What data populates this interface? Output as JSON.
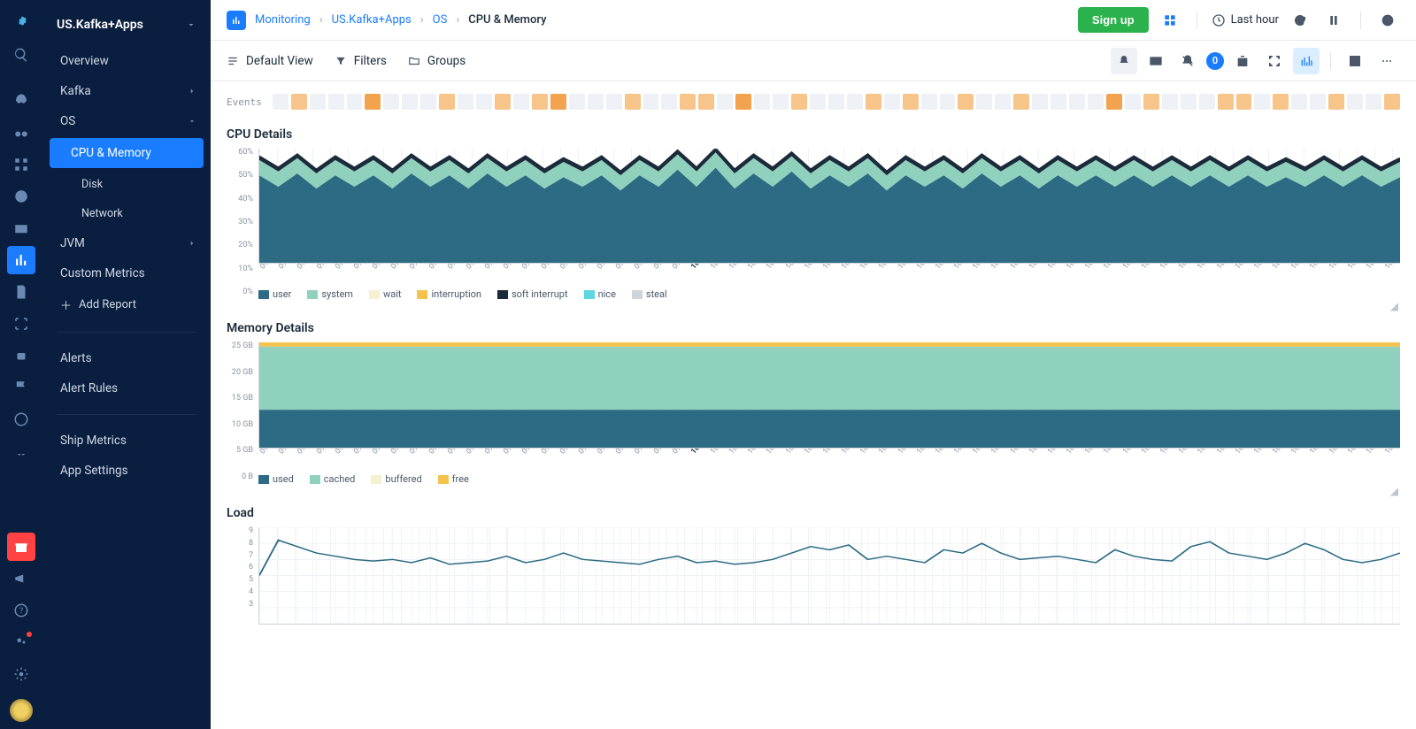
{
  "app_name": "US.Kafka+Apps",
  "breadcrumbs": [
    "Monitoring",
    "US.Kafka+Apps",
    "OS",
    "CPU & Memory"
  ],
  "actions": {
    "signup": "Sign up",
    "time_range": "Last hour"
  },
  "toolbar": {
    "default_view": "Default View",
    "filters": "Filters",
    "groups": "Groups",
    "badge": "0"
  },
  "sidebar": {
    "items": [
      {
        "label": "Overview"
      },
      {
        "label": "Kafka",
        "expandable": true
      },
      {
        "label": "OS",
        "expandable": true,
        "open": true,
        "children": [
          {
            "label": "CPU & Memory",
            "selected": true
          },
          {
            "label": "Disk"
          },
          {
            "label": "Network"
          }
        ]
      },
      {
        "label": "JVM",
        "expandable": true
      },
      {
        "label": "Custom Metrics"
      }
    ],
    "add_report": "Add Report",
    "group2": [
      {
        "label": "Alerts"
      },
      {
        "label": "Alert Rules"
      }
    ],
    "group3": [
      {
        "label": "Ship Metrics"
      },
      {
        "label": "App Settings"
      }
    ]
  },
  "events_label": "Events",
  "events_cells": [
    "g",
    "o1",
    "g",
    "g",
    "g",
    "o2",
    "g",
    "g",
    "g",
    "o1",
    "g",
    "g",
    "o1",
    "g",
    "o1",
    "o2",
    "g",
    "g",
    "g",
    "o1",
    "g",
    "g",
    "o1",
    "o1",
    "g",
    "o2",
    "g",
    "g",
    "o1",
    "g",
    "g",
    "g",
    "o1",
    "g",
    "o1",
    "g",
    "g",
    "o1",
    "g",
    "g",
    "o1",
    "g",
    "g",
    "g",
    "g",
    "o2",
    "g",
    "o1",
    "g",
    "g",
    "g",
    "o1",
    "o1",
    "g",
    "o1",
    "g",
    "g",
    "o1",
    "g",
    "g",
    "o1"
  ],
  "time_ticks": [
    "09:37",
    "09:38",
    "09:39",
    "09:40",
    "09:41",
    "09:42",
    "09:43",
    "09:44",
    "09:45",
    "09:46",
    "09:47",
    "09:48",
    "09:49",
    "09:50",
    "09:51",
    "09:52",
    "09:53",
    "09:54",
    "09:55",
    "09:56",
    "09:57",
    "09:58",
    "09:59",
    "10:00",
    "10:01",
    "10:02",
    "10:03",
    "10:04",
    "10:05",
    "10:06",
    "10:07",
    "10:08",
    "10:09",
    "10:10",
    "10:11",
    "10:12",
    "10:13",
    "10:14",
    "10:15",
    "10:16",
    "10:17",
    "10:18",
    "10:19",
    "10:20",
    "10:21",
    "10:22",
    "10:23",
    "10:24",
    "10:25",
    "10:26",
    "10:27",
    "10:28",
    "10:29",
    "10:30",
    "10:31",
    "10:32",
    "10:33",
    "10:34",
    "10:35",
    "10:36",
    "10:37"
  ],
  "panels": {
    "cpu": {
      "title": "CPU Details",
      "y_ticks": [
        "60%",
        "50%",
        "40%",
        "30%",
        "20%",
        "10%",
        "0%"
      ],
      "legend": [
        "user",
        "system",
        "wait",
        "interruption",
        "soft interrupt",
        "nice",
        "steal"
      ],
      "legend_colors": [
        "#2d6b84",
        "#8fd1bd",
        "#f5f0d0",
        "#f5c24e",
        "#1c2b3a",
        "#5cd6e0",
        "#d0d5dc"
      ]
    },
    "memory": {
      "title": "Memory Details",
      "y_ticks": [
        "25 GB",
        "20 GB",
        "15 GB",
        "10 GB",
        "5 GB",
        "0 B"
      ],
      "legend": [
        "used",
        "cached",
        "buffered",
        "free"
      ],
      "legend_colors": [
        "#2d6b84",
        "#8fd1bd",
        "#f5f0d0",
        "#f5c24e"
      ]
    },
    "load": {
      "title": "Load",
      "y_ticks": [
        "9",
        "8",
        "7",
        "6",
        "5",
        "4",
        "3"
      ]
    }
  },
  "chart_data": [
    {
      "type": "area",
      "title": "CPU Details",
      "ylabel": "%",
      "ylim": [
        0,
        60
      ],
      "x": [
        "09:37",
        "09:38",
        "09:39",
        "09:40",
        "09:41",
        "09:42",
        "09:43",
        "09:44",
        "09:45",
        "09:46",
        "09:47",
        "09:48",
        "09:49",
        "09:50",
        "09:51",
        "09:52",
        "09:53",
        "09:54",
        "09:55",
        "09:56",
        "09:57",
        "09:58",
        "09:59",
        "10:00",
        "10:01",
        "10:02",
        "10:03",
        "10:04",
        "10:05",
        "10:06",
        "10:07",
        "10:08",
        "10:09",
        "10:10",
        "10:11",
        "10:12",
        "10:13",
        "10:14",
        "10:15",
        "10:16",
        "10:17",
        "10:18",
        "10:19",
        "10:20",
        "10:21",
        "10:22",
        "10:23",
        "10:24",
        "10:25",
        "10:26",
        "10:27",
        "10:28",
        "10:29",
        "10:30",
        "10:31",
        "10:32",
        "10:33",
        "10:34",
        "10:35",
        "10:36",
        "10:37"
      ],
      "series": [
        {
          "name": "user",
          "values": [
            46,
            40,
            47,
            39,
            46,
            40,
            46,
            39,
            47,
            40,
            46,
            39,
            47,
            40,
            46,
            39,
            45,
            40,
            46,
            38,
            46,
            40,
            49,
            40,
            50,
            39,
            47,
            40,
            48,
            39,
            46,
            40,
            47,
            38,
            46,
            40,
            46,
            39,
            47,
            40,
            46,
            39,
            46,
            40,
            46,
            40,
            46,
            40,
            46,
            40,
            46,
            40,
            46,
            40,
            45,
            40,
            46,
            40,
            46,
            40,
            45
          ]
        },
        {
          "name": "system",
          "values": [
            8,
            8,
            8,
            8,
            8,
            8,
            8,
            8,
            8,
            8,
            8,
            8,
            8,
            8,
            8,
            8,
            8,
            8,
            8,
            8,
            8,
            8,
            8,
            8,
            8,
            8,
            8,
            8,
            8,
            8,
            8,
            8,
            8,
            8,
            8,
            8,
            8,
            8,
            8,
            8,
            8,
            8,
            8,
            8,
            8,
            8,
            8,
            8,
            8,
            8,
            8,
            8,
            8,
            8,
            8,
            8,
            8,
            8,
            8,
            8,
            8
          ]
        },
        {
          "name": "soft interrupt",
          "values": [
            2,
            2,
            2,
            2,
            2,
            2,
            2,
            2,
            2,
            2,
            2,
            2,
            2,
            2,
            2,
            2,
            2,
            2,
            2,
            2,
            2,
            2,
            2,
            2,
            2,
            2,
            2,
            2,
            2,
            2,
            2,
            2,
            2,
            2,
            2,
            2,
            2,
            2,
            2,
            2,
            2,
            2,
            2,
            2,
            2,
            2,
            2,
            2,
            2,
            2,
            2,
            2,
            2,
            2,
            2,
            2,
            2,
            2,
            2,
            2,
            2
          ]
        }
      ]
    },
    {
      "type": "area",
      "title": "Memory Details",
      "ylabel": "GB",
      "ylim": [
        0,
        25
      ],
      "x": [
        "09:37",
        "09:38",
        "09:39",
        "09:40",
        "09:41",
        "09:42",
        "09:43",
        "09:44",
        "09:45",
        "09:46",
        "09:47",
        "09:48",
        "09:49",
        "09:50",
        "09:51",
        "09:52",
        "09:53",
        "09:54",
        "09:55",
        "09:56",
        "09:57",
        "09:58",
        "09:59",
        "10:00",
        "10:01",
        "10:02",
        "10:03",
        "10:04",
        "10:05",
        "10:06",
        "10:07",
        "10:08",
        "10:09",
        "10:10",
        "10:11",
        "10:12",
        "10:13",
        "10:14",
        "10:15",
        "10:16",
        "10:17",
        "10:18",
        "10:19",
        "10:20",
        "10:21",
        "10:22",
        "10:23",
        "10:24",
        "10:25",
        "10:26",
        "10:27",
        "10:28",
        "10:29",
        "10:30",
        "10:31",
        "10:32",
        "10:33",
        "10:34",
        "10:35",
        "10:36",
        "10:37"
      ],
      "series": [
        {
          "name": "used",
          "values": [
            9,
            9,
            9,
            9,
            9,
            9,
            9,
            9,
            9,
            9,
            9,
            9,
            9,
            9,
            9,
            9,
            9,
            9,
            9,
            9,
            9,
            9,
            9,
            9,
            9,
            9,
            9,
            9,
            9,
            9,
            9,
            9,
            9,
            9,
            9,
            9,
            9,
            9,
            9,
            9,
            9,
            9,
            9,
            9,
            9,
            9,
            9,
            9,
            9,
            9,
            9,
            9,
            9,
            9,
            9,
            9,
            9,
            9,
            9,
            9,
            9
          ]
        },
        {
          "name": "cached",
          "values": [
            15,
            15,
            15,
            15,
            15,
            15,
            15,
            15,
            15,
            15,
            15,
            15,
            15,
            15,
            15,
            15,
            15,
            15,
            15,
            15,
            15,
            15,
            15,
            15,
            15,
            15,
            15,
            15,
            15,
            15,
            15,
            15,
            15,
            15,
            15,
            15,
            15,
            15,
            15,
            15,
            15,
            15,
            15,
            15,
            15,
            15,
            15,
            15,
            15,
            15,
            15,
            15,
            15,
            15,
            15,
            15,
            15,
            15,
            15,
            15,
            15
          ]
        },
        {
          "name": "free",
          "values": [
            1,
            1,
            1,
            1,
            1,
            1,
            1,
            1,
            1,
            1,
            1,
            1,
            1,
            1,
            1,
            1,
            1,
            1,
            1,
            1,
            1,
            1,
            1,
            1,
            1,
            1,
            1,
            1,
            1,
            1,
            1,
            1,
            1,
            1,
            1,
            1,
            1,
            1,
            1,
            1,
            1,
            1,
            1,
            1,
            1,
            1,
            1,
            1,
            1,
            1,
            1,
            1,
            1,
            1,
            1,
            1,
            1,
            1,
            1,
            1,
            1
          ]
        }
      ]
    },
    {
      "type": "line",
      "title": "Load",
      "ylim": [
        3,
        9
      ],
      "x": [
        "09:37",
        "09:38",
        "09:39",
        "09:40",
        "09:41",
        "09:42",
        "09:43",
        "09:44",
        "09:45",
        "09:46",
        "09:47",
        "09:48",
        "09:49",
        "09:50",
        "09:51",
        "09:52",
        "09:53",
        "09:54",
        "09:55",
        "09:56",
        "09:57",
        "09:58",
        "09:59",
        "10:00",
        "10:01",
        "10:02",
        "10:03",
        "10:04",
        "10:05",
        "10:06",
        "10:07",
        "10:08",
        "10:09",
        "10:10",
        "10:11",
        "10:12",
        "10:13",
        "10:14",
        "10:15",
        "10:16",
        "10:17",
        "10:18",
        "10:19",
        "10:20",
        "10:21",
        "10:22",
        "10:23",
        "10:24",
        "10:25",
        "10:26",
        "10:27",
        "10:28",
        "10:29",
        "10:30",
        "10:31",
        "10:32",
        "10:33",
        "10:34",
        "10:35",
        "10:36",
        "10:37"
      ],
      "series": [
        {
          "name": "load",
          "values": [
            6.0,
            8.2,
            7.8,
            7.4,
            7.2,
            7.0,
            6.9,
            7.0,
            6.8,
            7.1,
            6.7,
            6.8,
            6.9,
            7.2,
            6.8,
            7.0,
            7.4,
            7.0,
            6.9,
            6.8,
            6.7,
            7.0,
            7.2,
            6.8,
            6.9,
            6.7,
            6.8,
            7.0,
            7.4,
            7.8,
            7.6,
            7.9,
            7.0,
            7.2,
            7.0,
            6.8,
            7.6,
            7.4,
            8.0,
            7.4,
            7.0,
            7.1,
            7.2,
            7.0,
            6.8,
            7.6,
            7.2,
            7.0,
            6.9,
            7.8,
            8.1,
            7.4,
            7.2,
            7.0,
            7.4,
            8.0,
            7.6,
            7.0,
            6.8,
            7.0,
            7.4
          ]
        }
      ]
    }
  ]
}
